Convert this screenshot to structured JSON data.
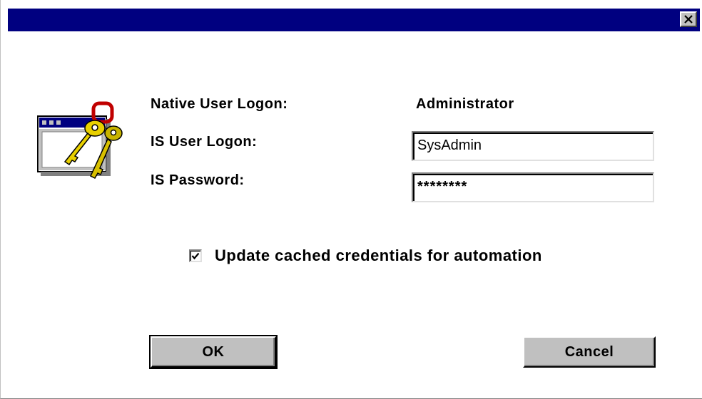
{
  "titlebar": {
    "close_label": "×"
  },
  "form": {
    "native_logon_label": "Native User Logon:",
    "native_logon_value": "Administrator",
    "is_logon_label": "IS User Logon:",
    "is_logon_value": "SysAdmin",
    "is_password_label": "IS Password:",
    "is_password_value": "********"
  },
  "options": {
    "update_cached_label": "Update cached credentials for automation",
    "update_cached_checked": true
  },
  "buttons": {
    "ok_label": "OK",
    "cancel_label": "Cancel"
  },
  "colors": {
    "titlebar": "#000080",
    "face": "#c0c0c0"
  },
  "icons": {
    "app": "keys-window-icon",
    "close": "close-icon",
    "check": "checkmark-icon"
  }
}
